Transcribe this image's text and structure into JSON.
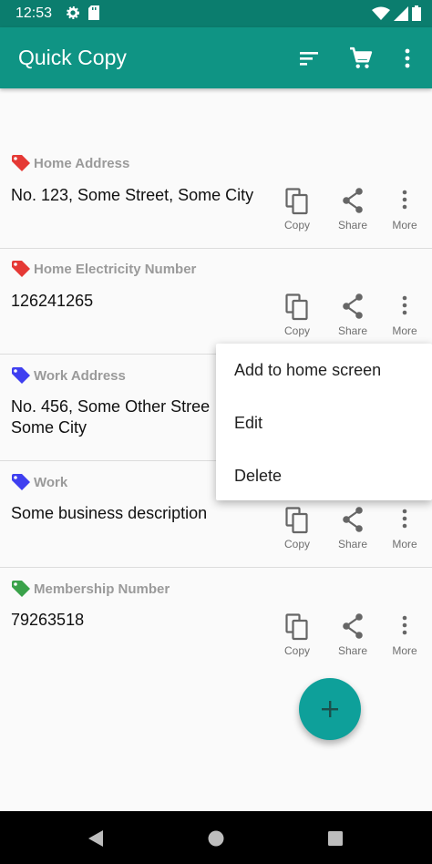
{
  "status_bar": {
    "time": "12:53"
  },
  "app_bar": {
    "title": "Quick Copy"
  },
  "cards": [
    {
      "tag": "Home Address",
      "tag_color": "#e53935",
      "value_lines": [
        "No. 123, Some Street, Some City"
      ]
    },
    {
      "tag": "Home Electricity Number",
      "tag_color": "#e53935",
      "value_lines": [
        "126241265"
      ]
    },
    {
      "tag": "Work Address",
      "tag_color": "#3f3ff0",
      "value_lines": [
        "No. 456, Some Other Stree",
        "Some City"
      ]
    },
    {
      "tag": "Work",
      "tag_color": "#3f3ff0",
      "value_lines": [
        "Some business description"
      ]
    },
    {
      "tag": "Membership Number",
      "tag_color": "#3aa24a",
      "value_lines": [
        "79263518"
      ]
    }
  ],
  "actions": {
    "copy": "Copy",
    "share": "Share",
    "more": "More"
  },
  "menu": {
    "add_to_home": "Add to home screen",
    "edit": "Edit",
    "delete": "Delete"
  },
  "colors": {
    "primary": "#0f9484",
    "primary_dark": "#0b7d6e",
    "fab": "#0ea09a"
  }
}
